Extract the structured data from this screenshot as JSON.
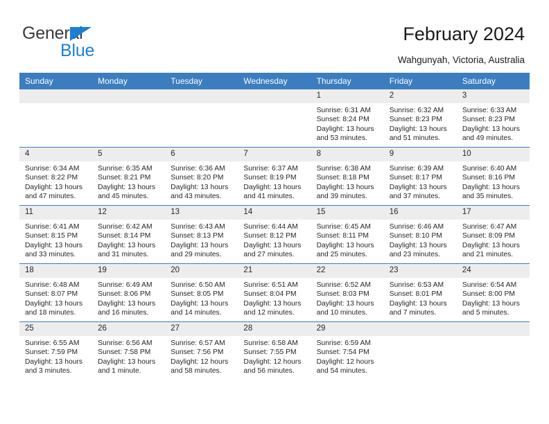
{
  "logo": {
    "line1": "General",
    "line2": "Blue",
    "triangle_color": "#1b7fd4",
    "text_color": "#3a3a3a"
  },
  "header": {
    "title": "February 2024",
    "subtitle": "Wahgunyah, Victoria, Australia"
  },
  "theme": {
    "header_blue": "#3b7dbf",
    "daynum_gray": "#ededed",
    "text": "#262626"
  },
  "calendar": {
    "weekdays": [
      "Sunday",
      "Monday",
      "Tuesday",
      "Wednesday",
      "Thursday",
      "Friday",
      "Saturday"
    ],
    "weeks": [
      [
        {
          "day": "",
          "sunrise": "",
          "sunset": "",
          "daylight": "",
          "daylight2": ""
        },
        {
          "day": "",
          "sunrise": "",
          "sunset": "",
          "daylight": "",
          "daylight2": ""
        },
        {
          "day": "",
          "sunrise": "",
          "sunset": "",
          "daylight": "",
          "daylight2": ""
        },
        {
          "day": "",
          "sunrise": "",
          "sunset": "",
          "daylight": "",
          "daylight2": ""
        },
        {
          "day": "1",
          "sunrise": "Sunrise: 6:31 AM",
          "sunset": "Sunset: 8:24 PM",
          "daylight": "Daylight: 13 hours",
          "daylight2": "and 53 minutes."
        },
        {
          "day": "2",
          "sunrise": "Sunrise: 6:32 AM",
          "sunset": "Sunset: 8:23 PM",
          "daylight": "Daylight: 13 hours",
          "daylight2": "and 51 minutes."
        },
        {
          "day": "3",
          "sunrise": "Sunrise: 6:33 AM",
          "sunset": "Sunset: 8:23 PM",
          "daylight": "Daylight: 13 hours",
          "daylight2": "and 49 minutes."
        }
      ],
      [
        {
          "day": "4",
          "sunrise": "Sunrise: 6:34 AM",
          "sunset": "Sunset: 8:22 PM",
          "daylight": "Daylight: 13 hours",
          "daylight2": "and 47 minutes."
        },
        {
          "day": "5",
          "sunrise": "Sunrise: 6:35 AM",
          "sunset": "Sunset: 8:21 PM",
          "daylight": "Daylight: 13 hours",
          "daylight2": "and 45 minutes."
        },
        {
          "day": "6",
          "sunrise": "Sunrise: 6:36 AM",
          "sunset": "Sunset: 8:20 PM",
          "daylight": "Daylight: 13 hours",
          "daylight2": "and 43 minutes."
        },
        {
          "day": "7",
          "sunrise": "Sunrise: 6:37 AM",
          "sunset": "Sunset: 8:19 PM",
          "daylight": "Daylight: 13 hours",
          "daylight2": "and 41 minutes."
        },
        {
          "day": "8",
          "sunrise": "Sunrise: 6:38 AM",
          "sunset": "Sunset: 8:18 PM",
          "daylight": "Daylight: 13 hours",
          "daylight2": "and 39 minutes."
        },
        {
          "day": "9",
          "sunrise": "Sunrise: 6:39 AM",
          "sunset": "Sunset: 8:17 PM",
          "daylight": "Daylight: 13 hours",
          "daylight2": "and 37 minutes."
        },
        {
          "day": "10",
          "sunrise": "Sunrise: 6:40 AM",
          "sunset": "Sunset: 8:16 PM",
          "daylight": "Daylight: 13 hours",
          "daylight2": "and 35 minutes."
        }
      ],
      [
        {
          "day": "11",
          "sunrise": "Sunrise: 6:41 AM",
          "sunset": "Sunset: 8:15 PM",
          "daylight": "Daylight: 13 hours",
          "daylight2": "and 33 minutes."
        },
        {
          "day": "12",
          "sunrise": "Sunrise: 6:42 AM",
          "sunset": "Sunset: 8:14 PM",
          "daylight": "Daylight: 13 hours",
          "daylight2": "and 31 minutes."
        },
        {
          "day": "13",
          "sunrise": "Sunrise: 6:43 AM",
          "sunset": "Sunset: 8:13 PM",
          "daylight": "Daylight: 13 hours",
          "daylight2": "and 29 minutes."
        },
        {
          "day": "14",
          "sunrise": "Sunrise: 6:44 AM",
          "sunset": "Sunset: 8:12 PM",
          "daylight": "Daylight: 13 hours",
          "daylight2": "and 27 minutes."
        },
        {
          "day": "15",
          "sunrise": "Sunrise: 6:45 AM",
          "sunset": "Sunset: 8:11 PM",
          "daylight": "Daylight: 13 hours",
          "daylight2": "and 25 minutes."
        },
        {
          "day": "16",
          "sunrise": "Sunrise: 6:46 AM",
          "sunset": "Sunset: 8:10 PM",
          "daylight": "Daylight: 13 hours",
          "daylight2": "and 23 minutes."
        },
        {
          "day": "17",
          "sunrise": "Sunrise: 6:47 AM",
          "sunset": "Sunset: 8:09 PM",
          "daylight": "Daylight: 13 hours",
          "daylight2": "and 21 minutes."
        }
      ],
      [
        {
          "day": "18",
          "sunrise": "Sunrise: 6:48 AM",
          "sunset": "Sunset: 8:07 PM",
          "daylight": "Daylight: 13 hours",
          "daylight2": "and 18 minutes."
        },
        {
          "day": "19",
          "sunrise": "Sunrise: 6:49 AM",
          "sunset": "Sunset: 8:06 PM",
          "daylight": "Daylight: 13 hours",
          "daylight2": "and 16 minutes."
        },
        {
          "day": "20",
          "sunrise": "Sunrise: 6:50 AM",
          "sunset": "Sunset: 8:05 PM",
          "daylight": "Daylight: 13 hours",
          "daylight2": "and 14 minutes."
        },
        {
          "day": "21",
          "sunrise": "Sunrise: 6:51 AM",
          "sunset": "Sunset: 8:04 PM",
          "daylight": "Daylight: 13 hours",
          "daylight2": "and 12 minutes."
        },
        {
          "day": "22",
          "sunrise": "Sunrise: 6:52 AM",
          "sunset": "Sunset: 8:03 PM",
          "daylight": "Daylight: 13 hours",
          "daylight2": "and 10 minutes."
        },
        {
          "day": "23",
          "sunrise": "Sunrise: 6:53 AM",
          "sunset": "Sunset: 8:01 PM",
          "daylight": "Daylight: 13 hours",
          "daylight2": "and 7 minutes."
        },
        {
          "day": "24",
          "sunrise": "Sunrise: 6:54 AM",
          "sunset": "Sunset: 8:00 PM",
          "daylight": "Daylight: 13 hours",
          "daylight2": "and 5 minutes."
        }
      ],
      [
        {
          "day": "25",
          "sunrise": "Sunrise: 6:55 AM",
          "sunset": "Sunset: 7:59 PM",
          "daylight": "Daylight: 13 hours",
          "daylight2": "and 3 minutes."
        },
        {
          "day": "26",
          "sunrise": "Sunrise: 6:56 AM",
          "sunset": "Sunset: 7:58 PM",
          "daylight": "Daylight: 13 hours",
          "daylight2": "and 1 minute."
        },
        {
          "day": "27",
          "sunrise": "Sunrise: 6:57 AM",
          "sunset": "Sunset: 7:56 PM",
          "daylight": "Daylight: 12 hours",
          "daylight2": "and 58 minutes."
        },
        {
          "day": "28",
          "sunrise": "Sunrise: 6:58 AM",
          "sunset": "Sunset: 7:55 PM",
          "daylight": "Daylight: 12 hours",
          "daylight2": "and 56 minutes."
        },
        {
          "day": "29",
          "sunrise": "Sunrise: 6:59 AM",
          "sunset": "Sunset: 7:54 PM",
          "daylight": "Daylight: 12 hours",
          "daylight2": "and 54 minutes."
        },
        {
          "day": "",
          "sunrise": "",
          "sunset": "",
          "daylight": "",
          "daylight2": ""
        },
        {
          "day": "",
          "sunrise": "",
          "sunset": "",
          "daylight": "",
          "daylight2": ""
        }
      ]
    ]
  }
}
